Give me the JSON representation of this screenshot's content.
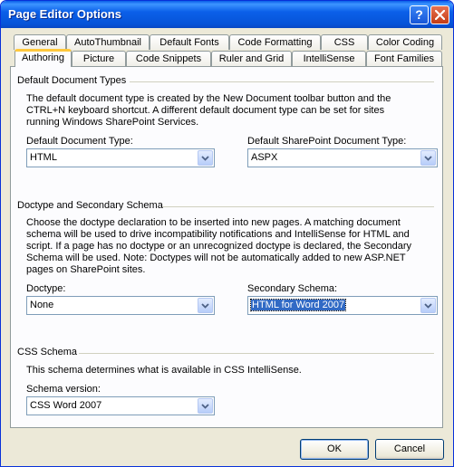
{
  "window": {
    "title": "Page Editor Options",
    "help_button": "?"
  },
  "tabs": {
    "row1": [
      "General",
      "AutoThumbnail",
      "Default Fonts",
      "Code Formatting",
      "CSS",
      "Color Coding"
    ],
    "row2": [
      "Authoring",
      "Picture",
      "Code Snippets",
      "Ruler and Grid",
      "IntelliSense",
      "Font Families"
    ],
    "active": "Authoring"
  },
  "default_doc_types": {
    "title": "Default Document Types",
    "description": "The default document type is created by the New Document toolbar button and the CTRL+N keyboard shortcut. A different default document type can be set for sites running Windows SharePoint Services.",
    "default_type_label": "Default Document Type:",
    "default_type_value": "HTML",
    "sharepoint_type_label": "Default SharePoint Document Type:",
    "sharepoint_type_value": "ASPX"
  },
  "doctype_schema": {
    "title": "Doctype and Secondary Schema",
    "description": "Choose the doctype declaration to be inserted into new pages. A matching document schema will be used to drive incompatibility notifications and IntelliSense for HTML and script. If a page has no doctype or an unrecognized doctype is declared, the Secondary Schema will be used. Note: Doctypes will not be automatically added to new ASP.NET pages on SharePoint sites.",
    "doctype_label": "Doctype:",
    "doctype_value": "None",
    "secondary_label": "Secondary Schema:",
    "secondary_value": "HTML for Word 2007"
  },
  "css_schema": {
    "title": "CSS Schema",
    "description": "This schema determines what is available in CSS IntelliSense.",
    "version_label": "Schema version:",
    "version_value": "CSS Word 2007"
  },
  "buttons": {
    "ok": "OK",
    "cancel": "Cancel"
  },
  "colors": {
    "titlebar": "#0653d8",
    "dialog_bg": "#ece9d8",
    "active_tab_accent": "#ffc83c",
    "selection": "#316ac5"
  }
}
